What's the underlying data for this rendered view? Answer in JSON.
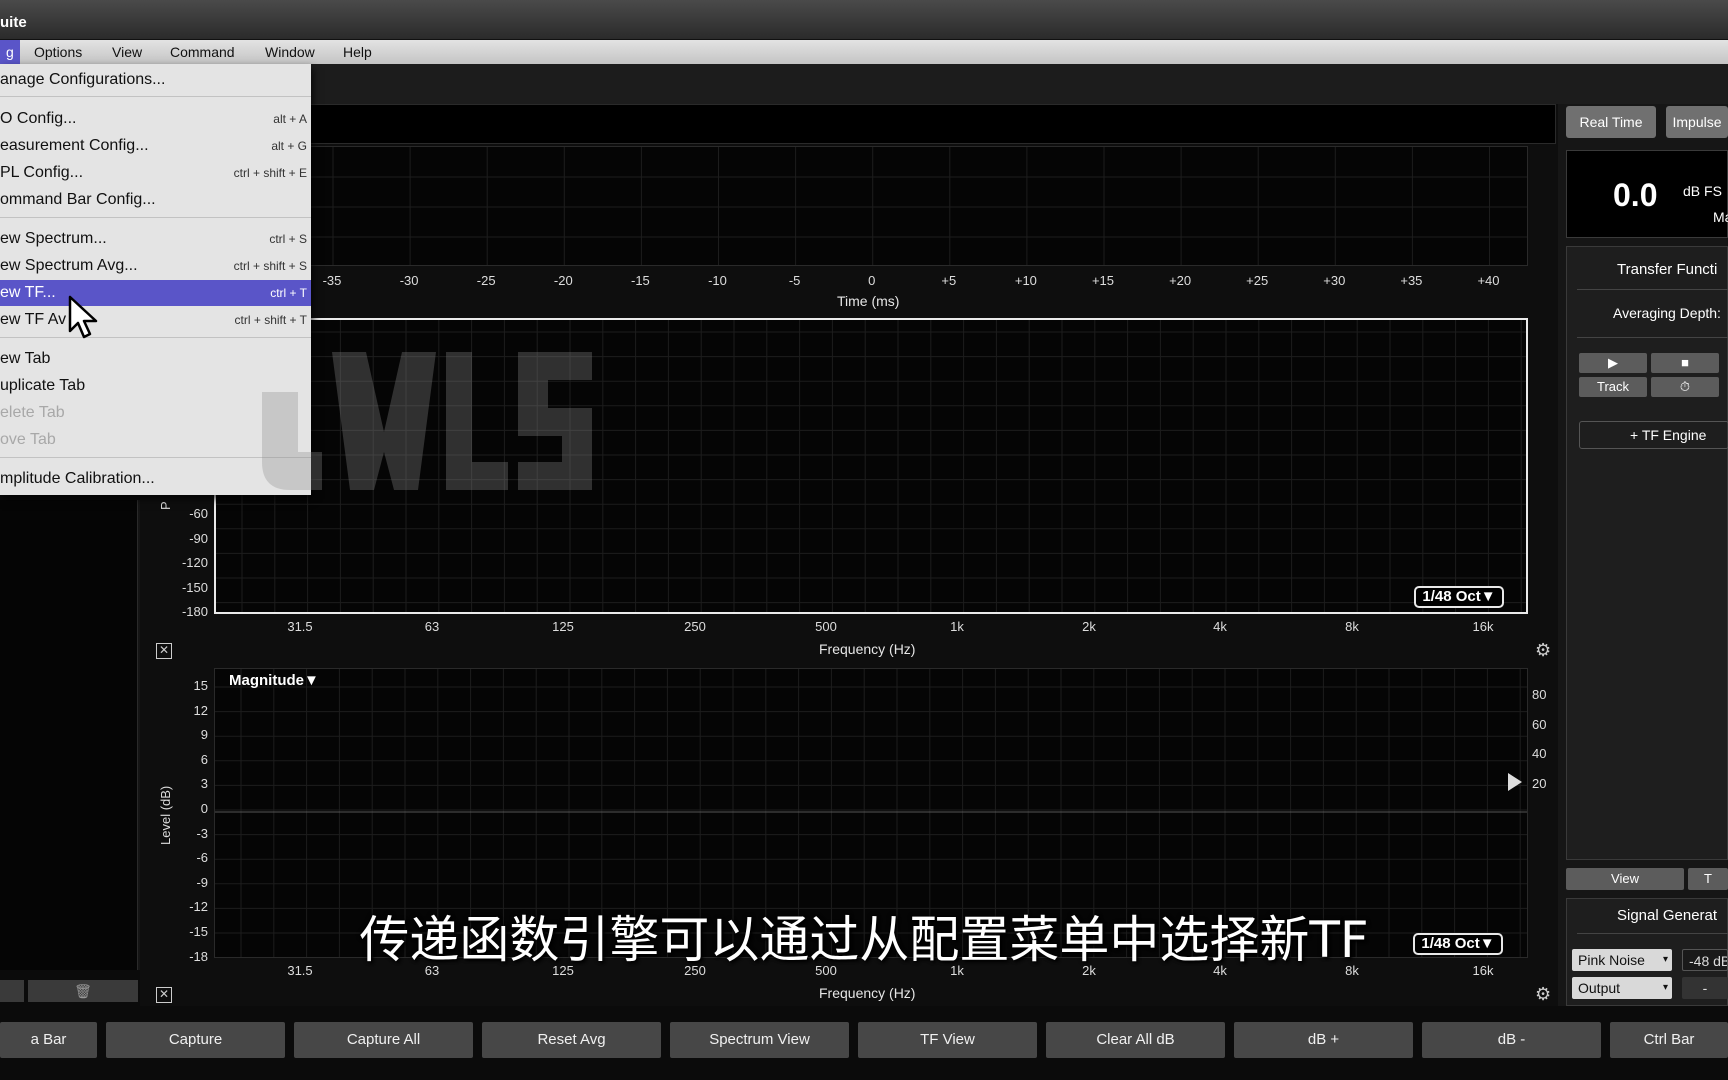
{
  "window": {
    "title": "uite"
  },
  "menubar": {
    "items": [
      "g",
      "Options",
      "View",
      "Command",
      "Window",
      "Help"
    ]
  },
  "dropdown": {
    "items": [
      {
        "label": "anage Configurations...",
        "shortcut": "",
        "state": "normal"
      },
      {
        "label": "O Config...",
        "shortcut": "alt + A",
        "state": "normal"
      },
      {
        "label": "easurement Config...",
        "shortcut": "alt + G",
        "state": "normal"
      },
      {
        "label": "PL Config...",
        "shortcut": "ctrl + shift + E",
        "state": "normal"
      },
      {
        "label": "ommand Bar Config...",
        "shortcut": "",
        "state": "normal"
      },
      {
        "label": "ew Spectrum...",
        "shortcut": "ctrl + S",
        "state": "normal"
      },
      {
        "label": "ew Spectrum Avg...",
        "shortcut": "ctrl + shift + S",
        "state": "normal"
      },
      {
        "label": "ew TF...",
        "shortcut": "ctrl + T",
        "state": "highlighted"
      },
      {
        "label": "ew TF Av",
        "shortcut": "ctrl + shift + T",
        "state": "normal"
      },
      {
        "label": "ew Tab",
        "shortcut": "",
        "state": "normal"
      },
      {
        "label": "uplicate Tab",
        "shortcut": "",
        "state": "normal"
      },
      {
        "label": "elete Tab",
        "shortcut": "",
        "state": "disabled"
      },
      {
        "label": "ove Tab",
        "shortcut": "",
        "state": "disabled"
      },
      {
        "label": "mplitude Calibration...",
        "shortcut": "",
        "state": "normal"
      }
    ]
  },
  "impulse_plot": {
    "x_ticks": [
      "-35",
      "-30",
      "-25",
      "-20",
      "-15",
      "-10",
      "-5",
      "0",
      "+5",
      "+10",
      "+15",
      "+20",
      "+25",
      "+30",
      "+35",
      "+40"
    ],
    "x_title": "Time (ms)"
  },
  "phase_plot": {
    "y_label": "P",
    "y_ticks": [
      "-60",
      "-90",
      "-120",
      "-150",
      "-180"
    ],
    "x_ticks": [
      "31.5",
      "63",
      "125",
      "250",
      "500",
      "1k",
      "2k",
      "4k",
      "8k",
      "16k"
    ],
    "x_title": "Frequency (Hz)",
    "smoothing": "1/48 Oct▼"
  },
  "magnitude_plot": {
    "mode_label": "Magnitude▼",
    "y_label": "Level (dB)",
    "y_ticks": [
      "15",
      "12",
      "9",
      "6",
      "3",
      "0",
      "-3",
      "-6",
      "-9",
      "-12",
      "-15",
      "-18"
    ],
    "y2_ticks": [
      "80",
      "60",
      "40",
      "20"
    ],
    "x_ticks": [
      "31.5",
      "63",
      "125",
      "250",
      "500",
      "1k",
      "2k",
      "4k",
      "8k",
      "16k"
    ],
    "x_title": "Frequency (Hz)",
    "smoothing": "1/48 Oct▼"
  },
  "right_panel": {
    "tabs": [
      "Real Time",
      "Impulse"
    ],
    "meter_value": "0.0",
    "meter_unit": "dB FS",
    "meter_sub": "Ma",
    "tf_header": "Transfer Functi",
    "averaging_label": "Averaging Depth:",
    "play_icon": "▶",
    "stop_icon": "■",
    "track_label": "Track",
    "timer_icon": "⏱",
    "add_engine": "+ TF Engine",
    "view_tabs": [
      "View",
      "T"
    ],
    "signal_header": "Signal Generat",
    "signal_type": "Pink Noise",
    "signal_level": "-48 dB",
    "output_label": "Output",
    "minus_label": "-"
  },
  "left_panel": {
    "trash_icon": "🗑"
  },
  "command_bar": {
    "buttons": [
      "a Bar",
      "Capture",
      "Capture All",
      "Reset Avg",
      "Spectrum View",
      "TF View",
      "Clear All dB",
      "dB +",
      "dB -",
      "Ctrl Bar"
    ]
  },
  "subtitle": "传递函数引擎可以通过从配置菜单中选择新TF"
}
